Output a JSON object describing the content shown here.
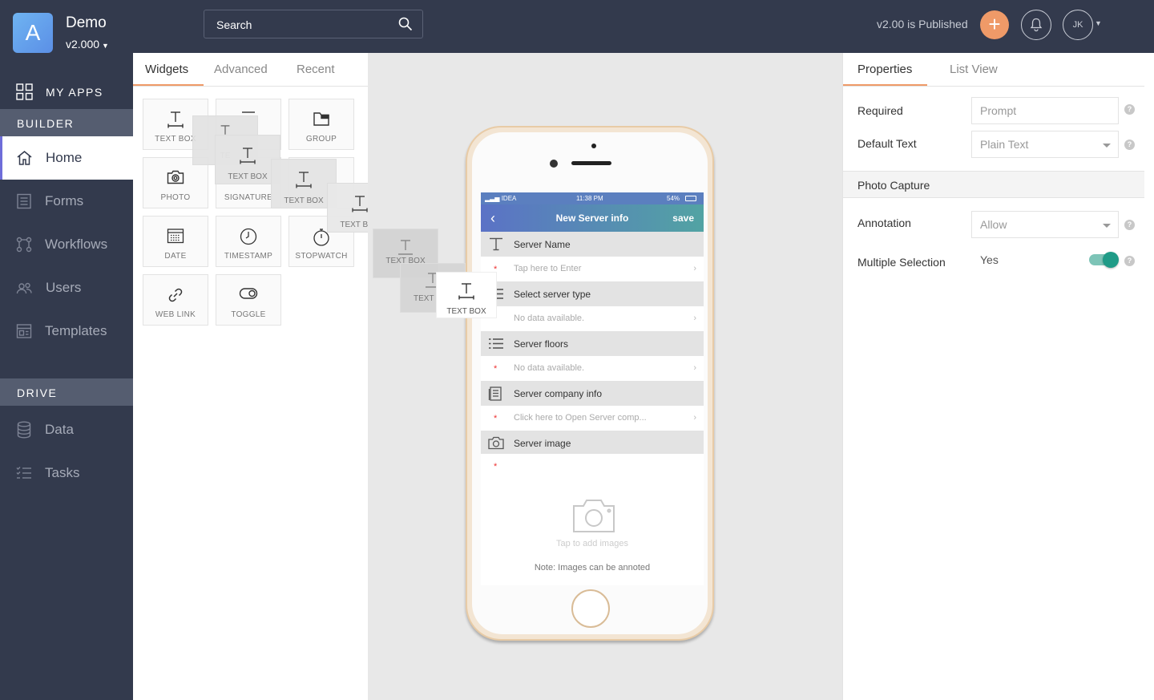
{
  "header": {
    "logo_letter": "A",
    "app_name": "Demo",
    "app_version": "v2.000",
    "search_placeholder": "Search",
    "publish_status": "v2.00 is Published",
    "add_label": "+",
    "avatar_initials": "JK",
    "accent_color": "#ef9a68"
  },
  "sidebar": {
    "my_apps": "MY APPS",
    "builder_header": "BUILDER",
    "builder_items": [
      {
        "label": "Home",
        "icon": "home-icon",
        "active": true
      },
      {
        "label": "Forms",
        "icon": "forms-icon"
      },
      {
        "label": "Workflows",
        "icon": "workflows-icon"
      },
      {
        "label": "Users",
        "icon": "users-icon"
      },
      {
        "label": "Templates",
        "icon": "templates-icon"
      }
    ],
    "drive_header": "DRIVE",
    "drive_items": [
      {
        "label": "Data",
        "icon": "data-icon"
      },
      {
        "label": "Tasks",
        "icon": "tasks-icon"
      }
    ]
  },
  "widgets_panel": {
    "tabs": [
      "Widgets",
      "Advanced",
      "Recent"
    ],
    "active_tab": "Widgets",
    "widgets": [
      {
        "label": "TEXT BOX",
        "icon": "text-box-icon"
      },
      {
        "label": "",
        "icon": "widget-icon"
      },
      {
        "label": "GROUP",
        "icon": "group-icon"
      },
      {
        "label": "PHOTO",
        "icon": "photo-icon"
      },
      {
        "label": "SIGNATURE",
        "icon": "signature-icon"
      },
      {
        "label": "",
        "icon": "widget-icon"
      },
      {
        "label": "DATE",
        "icon": "date-icon"
      },
      {
        "label": "TIMESTAMP",
        "icon": "timestamp-icon"
      },
      {
        "label": "STOPWATCH",
        "icon": "stopwatch-icon"
      },
      {
        "label": "WEB LINK",
        "icon": "web-link-icon"
      },
      {
        "label": "TOGGLE",
        "icon": "toggle-icon"
      }
    ],
    "drag_ghosts": [
      "TE",
      "TEXT BOX",
      "TEXT BOX",
      "TEXT BOX",
      "TEXT BOX",
      "TEXT B",
      "TEXT BOX"
    ]
  },
  "phone": {
    "status": {
      "carrier": "IDEA",
      "time": "11:38 PM",
      "battery": "54%"
    },
    "nav": {
      "back": "‹",
      "title": "New Server info",
      "save": "save"
    },
    "fields": [
      {
        "label": "Server Name",
        "icon": "text-field-icon",
        "value": "Tap here to Enter"
      },
      {
        "label": "Select server type",
        "icon": "list-icon",
        "value": "No data available."
      },
      {
        "label": "Server floors",
        "icon": "list-icon",
        "value": "No data available."
      },
      {
        "label": "Server company info",
        "icon": "document-icon",
        "value": "Click here to Open Server comp..."
      },
      {
        "label": "Server image",
        "icon": "camera-icon"
      }
    ],
    "image_tap": "Tap to add images",
    "image_note": "Note: Images can be annoted"
  },
  "properties": {
    "tabs": [
      "Properties",
      "List View"
    ],
    "required_label": "Required",
    "required_placeholder": "Prompt",
    "default_text_label": "Default Text",
    "default_text_value": "Plain Text",
    "section_title": "Photo Capture",
    "annotation_label": "Annotation",
    "annotation_value": "Allow",
    "multiple_selection_label": "Multiple Selection",
    "multiple_selection_value": "Yes",
    "help_glyph": "?",
    "toggle_color": "#1f9b87"
  }
}
